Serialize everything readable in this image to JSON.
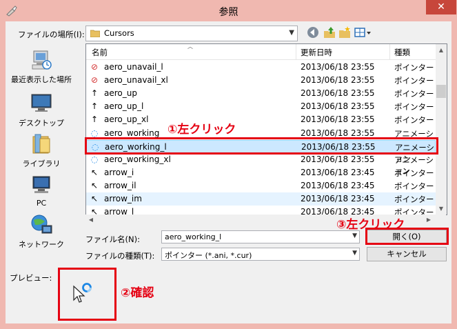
{
  "window": {
    "title": "参照",
    "close_glyph": "✕"
  },
  "location": {
    "label": "ファイルの場所(I):",
    "value": "Cursors"
  },
  "toolbar": {
    "back_icon": "back-arrow-icon",
    "up_icon": "up-folder-icon",
    "new_folder_icon": "new-folder-icon",
    "view_icon": "view-menu-icon"
  },
  "places": [
    {
      "label": "最近表示した場所",
      "icon": "recent-places-icon"
    },
    {
      "label": "デスクトップ",
      "icon": "desktop-icon"
    },
    {
      "label": "ライブラリ",
      "icon": "libraries-icon"
    },
    {
      "label": "PC",
      "icon": "computer-icon"
    },
    {
      "label": "ネットワーク",
      "icon": "network-icon"
    }
  ],
  "columns": {
    "name": "名前",
    "date": "更新日時",
    "type": "種類"
  },
  "files": [
    {
      "name": "aero_unavail_l",
      "date": "2013/06/18 23:55",
      "type": "ポインター",
      "icon": "⊘"
    },
    {
      "name": "aero_unavail_xl",
      "date": "2013/06/18 23:55",
      "type": "ポインター",
      "icon": "⊘"
    },
    {
      "name": "aero_up",
      "date": "2013/06/18 23:55",
      "type": "ポインター",
      "icon": "↑"
    },
    {
      "name": "aero_up_l",
      "date": "2013/06/18 23:55",
      "type": "ポインター",
      "icon": "↑"
    },
    {
      "name": "aero_up_xl",
      "date": "2013/06/18 23:55",
      "type": "ポインター",
      "icon": "↑"
    },
    {
      "name": "aero_working",
      "date": "2013/06/18 23:55",
      "type": "アニメーション",
      "icon": "◌"
    },
    {
      "name": "aero_working_l",
      "date": "2013/06/18 23:55",
      "type": "アニメーション",
      "icon": "◌"
    },
    {
      "name": "aero_working_xl",
      "date": "2013/06/18 23:55",
      "type": "アニメーション",
      "icon": "◌"
    },
    {
      "name": "arrow_i",
      "date": "2013/06/18 23:45",
      "type": "ポインター",
      "icon": "↖"
    },
    {
      "name": "arrow_il",
      "date": "2013/06/18 23:45",
      "type": "ポインター",
      "icon": "↖"
    },
    {
      "name": "arrow_im",
      "date": "2013/06/18 23:45",
      "type": "ポインター",
      "icon": "↖"
    },
    {
      "name": "arrow_l",
      "date": "2013/06/18 23:45",
      "type": "ポインター",
      "icon": "↖"
    }
  ],
  "filename": {
    "label": "ファイル名(N):",
    "value": "aero_working_l"
  },
  "filetype": {
    "label": "ファイルの種類(T):",
    "value": "ポインター (*.ani, *.cur)"
  },
  "buttons": {
    "open": "開く(O)",
    "cancel": "キャンセル"
  },
  "preview": {
    "label": "プレビュー:"
  },
  "annotations": {
    "step1": "①左クリック",
    "step2": "②確認",
    "step3": "③左クリック",
    "color": "#e50012"
  }
}
